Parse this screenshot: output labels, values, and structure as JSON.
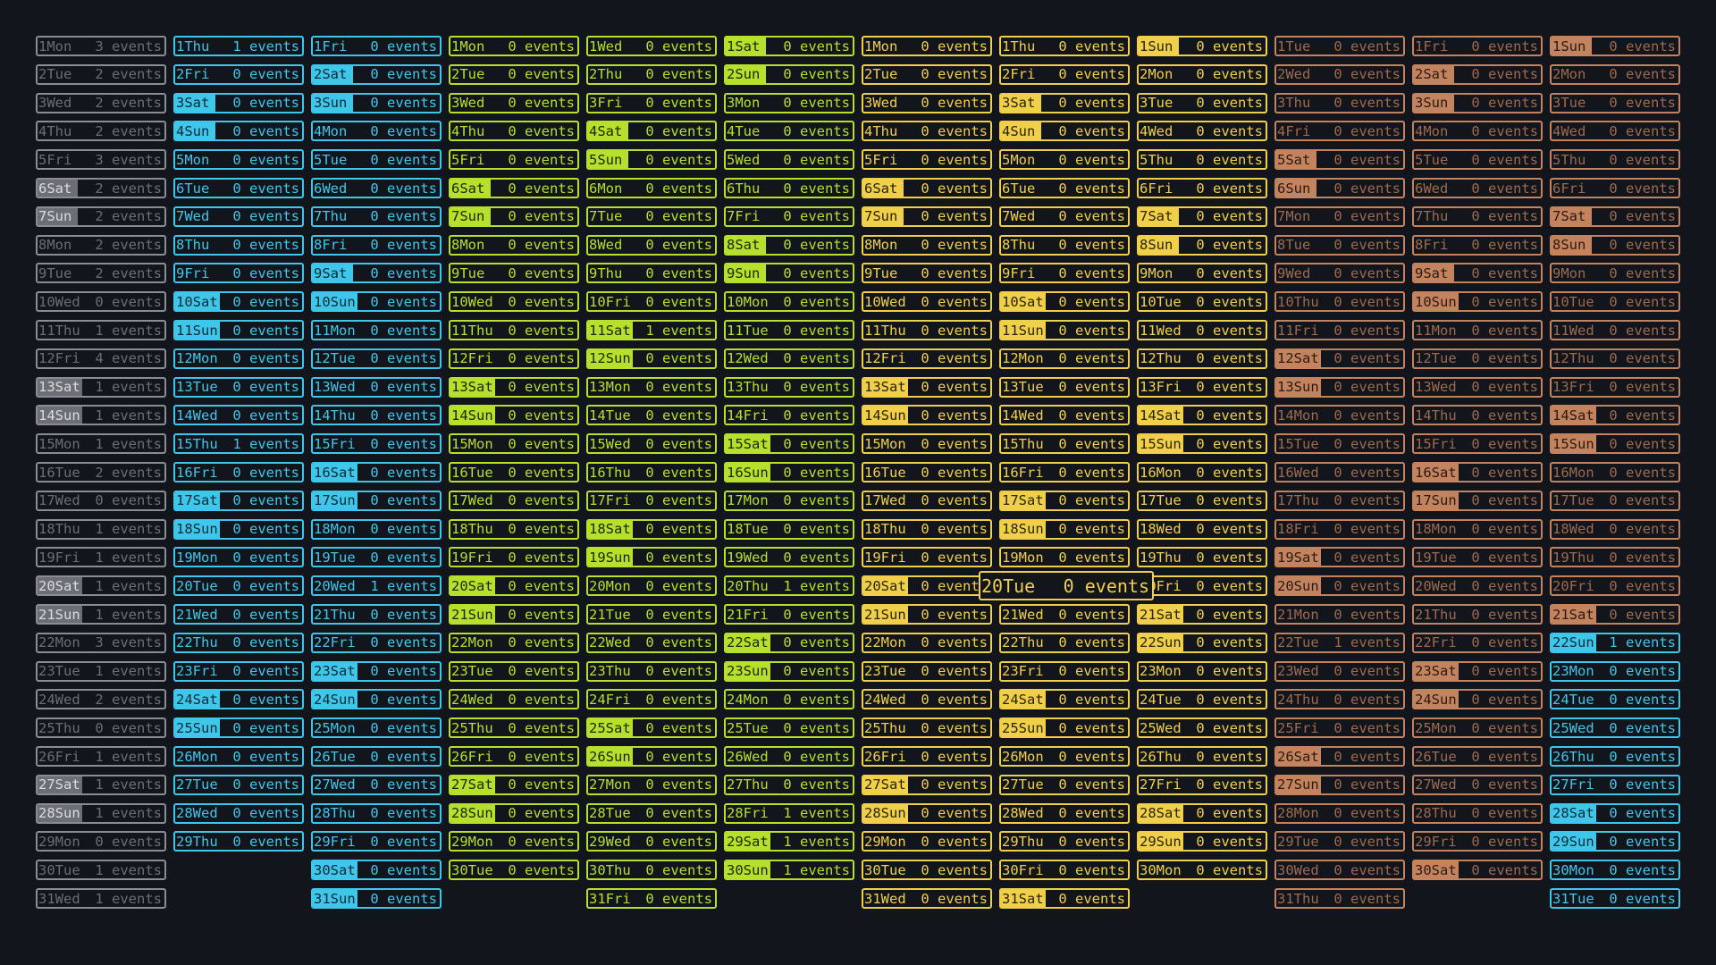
{
  "grid_title": "",
  "column_themes": [
    {
      "name": "gray",
      "color": "#8a8d93",
      "dim": "#6b6e74",
      "weekend_bg": "#6b6e74",
      "weekend_fg": "#dcdcdc"
    },
    {
      "name": "cyan",
      "color": "#3ec7ea",
      "dim": "#3ec7ea",
      "weekend_bg": "#3ec7ea",
      "weekend_fg": "#0e2a35"
    },
    {
      "name": "cyan",
      "color": "#3ec7ea",
      "dim": "#3ec7ea",
      "weekend_bg": "#3ec7ea",
      "weekend_fg": "#0e2a35"
    },
    {
      "name": "lime",
      "color": "#b6e02c",
      "dim": "#b6e02c",
      "weekend_bg": "#b6e02c",
      "weekend_fg": "#1b2604"
    },
    {
      "name": "lime",
      "color": "#b6e02c",
      "dim": "#b6e02c",
      "weekend_bg": "#b6e02c",
      "weekend_fg": "#1b2604"
    },
    {
      "name": "lime",
      "color": "#b6e02c",
      "dim": "#b6e02c",
      "weekend_bg": "#b6e02c",
      "weekend_fg": "#1b2604"
    },
    {
      "name": "yellow",
      "color": "#f0d04a",
      "dim": "#f0d04a",
      "weekend_bg": "#f0d04a",
      "weekend_fg": "#2a2305"
    },
    {
      "name": "yellow",
      "color": "#f0d04a",
      "dim": "#f0d04a",
      "weekend_bg": "#f0d04a",
      "weekend_fg": "#2a2305"
    },
    {
      "name": "yellow",
      "color": "#f0d04a",
      "dim": "#f0d04a",
      "weekend_bg": "#f0d04a",
      "weekend_fg": "#2a2305"
    },
    {
      "name": "orange",
      "color": "#c2835e",
      "dim": "#9c6a4e",
      "weekend_bg": "#c2835e",
      "weekend_fg": "#2b1a10"
    },
    {
      "name": "orange",
      "color": "#c2835e",
      "dim": "#9c6a4e",
      "weekend_bg": "#c2835e",
      "weekend_fg": "#2b1a10"
    },
    {
      "name": "orange",
      "color": "#c2835e",
      "dim": "#9c6a4e",
      "weekend_bg": "#c2835e",
      "weekend_fg": "#2b1a10"
    }
  ],
  "event_suffix": "events",
  "months": [
    {
      "first_weekday": "Mon",
      "days": 31,
      "events": {
        "1": 3,
        "2": 2,
        "3": 2,
        "4": 2,
        "5": 3,
        "6": 2,
        "7": 2,
        "8": 2,
        "9": 2,
        "10": 0,
        "11": 1,
        "12": 4,
        "13": 1,
        "14": 1,
        "15": 1,
        "16": 2,
        "17": 0,
        "18": 1,
        "19": 1,
        "20": 1,
        "21": 1,
        "22": 3,
        "23": 1,
        "24": 2,
        "25": 0,
        "26": 1,
        "27": 1,
        "28": 1,
        "29": 0,
        "30": 1,
        "31": 1
      }
    },
    {
      "first_weekday": "Thu",
      "days": 29,
      "events": {
        "1": 1,
        "15": 1
      }
    },
    {
      "first_weekday": "Fri",
      "days": 31,
      "events": {
        "20": 1
      }
    },
    {
      "first_weekday": "Mon",
      "days": 30,
      "events": {}
    },
    {
      "first_weekday": "Wed",
      "days": 31,
      "events": {
        "11": 1
      }
    },
    {
      "first_weekday": "Sat",
      "days": 30,
      "events": {
        "20": 1,
        "28": 1,
        "29": 1,
        "30": 1
      }
    },
    {
      "first_weekday": "Mon",
      "days": 31,
      "events": {}
    },
    {
      "first_weekday": "Thu",
      "days": 31,
      "events": {}
    },
    {
      "first_weekday": "Sun",
      "days": 30,
      "events": {}
    },
    {
      "first_weekday": "Tue",
      "days": 31,
      "events": {
        "22": 1
      }
    },
    {
      "first_weekday": "Fri",
      "days": 30,
      "events": {}
    },
    {
      "first_weekday": "Sun",
      "days": 31,
      "events": {
        "22": 1
      }
    }
  ],
  "late_recolor": {
    "month_index": 11,
    "from_day": 22,
    "theme_index": 1
  },
  "hovered_cell": {
    "month_index": 7,
    "day": 20
  }
}
